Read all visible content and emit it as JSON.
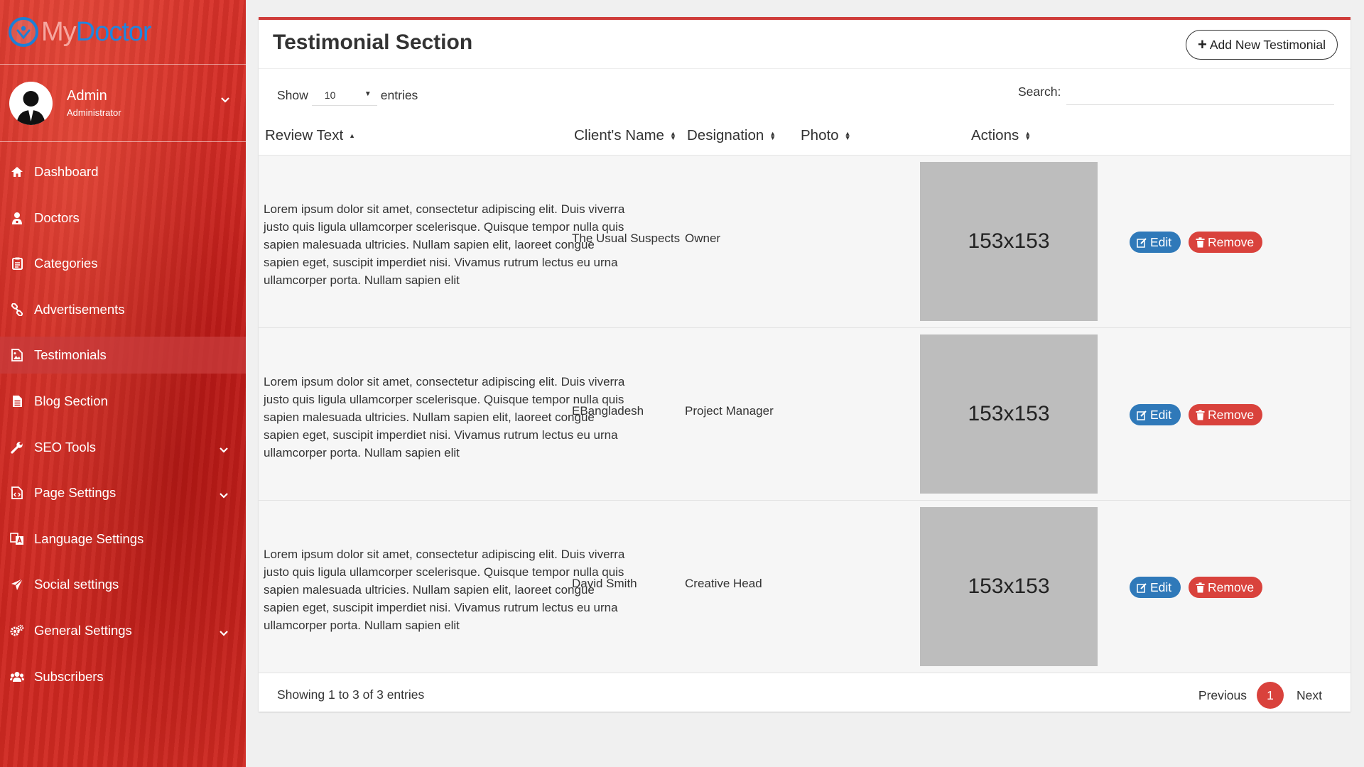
{
  "brand": {
    "name_part1": "My",
    "name_part2": "Doctor"
  },
  "user": {
    "name": "Admin",
    "role": "Administrator"
  },
  "nav": [
    {
      "label": "Dashboard",
      "icon": "home-icon"
    },
    {
      "label": "Doctors",
      "icon": "user-md-icon"
    },
    {
      "label": "Categories",
      "icon": "clipboard-icon"
    },
    {
      "label": "Advertisements",
      "icon": "link-icon"
    },
    {
      "label": "Testimonials",
      "icon": "image-file-icon",
      "active": true
    },
    {
      "label": "Blog Section",
      "icon": "file-text-icon"
    },
    {
      "label": "SEO Tools",
      "icon": "wrench-icon",
      "has_submenu": true
    },
    {
      "label": "Page Settings",
      "icon": "code-file-icon",
      "has_submenu": true
    },
    {
      "label": "Language Settings",
      "icon": "language-icon",
      "has_submenu": true
    },
    {
      "label": "Social settings",
      "icon": "paper-plane-icon"
    },
    {
      "label": "General Settings",
      "icon": "gears-icon",
      "has_submenu": true
    },
    {
      "label": "Subscribers",
      "icon": "users-icon"
    }
  ],
  "panel": {
    "title": "Testimonial Section",
    "add_button": "Add New Testimonial",
    "show_label": "Show",
    "entries_label": "entries",
    "page_length": "10",
    "search_label": "Search:",
    "search_value": ""
  },
  "table": {
    "headers": {
      "review": "Review Text",
      "client": "Client's Name",
      "designation": "Designation",
      "photo": "Photo",
      "actions": "Actions"
    },
    "rows": [
      {
        "review": "Lorem ipsum dolor sit amet, consectetur adipiscing elit. Duis viverra justo quis ligula ullamcorper scelerisque. Quisque tempor nulla quis sapien malesuada ultricies. Nullam sapien elit, laoreet congue sapien eget, suscipit imperdiet nisi. Vivamus rutrum lectus eu urna ullamcorper porta. Nullam sapien elit",
        "client": "The Usual Suspects",
        "designation": "Owner",
        "photo": "153x153",
        "edit": "Edit",
        "remove": "Remove"
      },
      {
        "review": "Lorem ipsum dolor sit amet, consectetur adipiscing elit. Duis viverra justo quis ligula ullamcorper scelerisque. Quisque tempor nulla quis sapien malesuada ultricies. Nullam sapien elit, laoreet congue sapien eget, suscipit imperdiet nisi. Vivamus rutrum lectus eu urna ullamcorper porta. Nullam sapien elit",
        "client": "EBangladesh",
        "designation": "Project Manager",
        "photo": "153x153",
        "edit": "Edit",
        "remove": "Remove"
      },
      {
        "review": "Lorem ipsum dolor sit amet, consectetur adipiscing elit. Duis viverra justo quis ligula ullamcorper scelerisque. Quisque tempor nulla quis sapien malesuada ultricies. Nullam sapien elit, laoreet congue sapien eget, suscipit imperdiet nisi. Vivamus rutrum lectus eu urna ullamcorper porta. Nullam sapien elit",
        "client": "David Smith",
        "designation": "Creative Head",
        "photo": "153x153",
        "edit": "Edit",
        "remove": "Remove"
      }
    ]
  },
  "footer": {
    "info": "Showing 1 to 3 of 3 entries",
    "previous": "Previous",
    "current_page": "1",
    "next": "Next"
  },
  "colors": {
    "accent": "#cf3c3a",
    "edit": "#2f79b9",
    "remove": "#d9423c"
  }
}
